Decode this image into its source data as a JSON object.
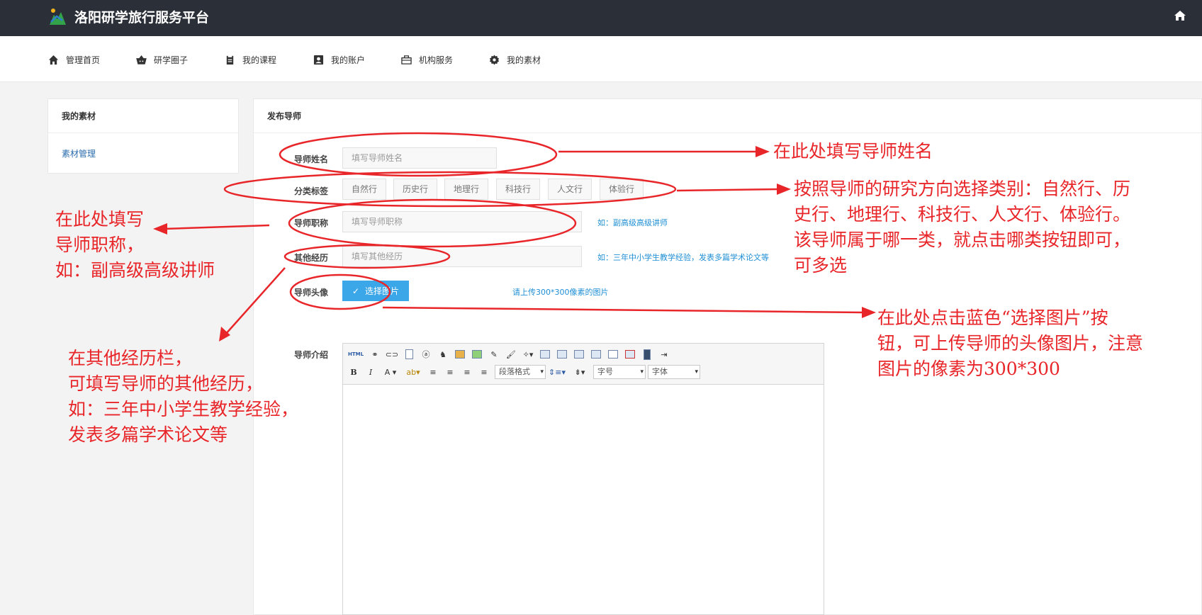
{
  "app": {
    "title": "洛阳研学旅行服务平台"
  },
  "nav": [
    {
      "label": "管理首页",
      "icon": "home-icon"
    },
    {
      "label": "研学圈子",
      "icon": "basket-icon"
    },
    {
      "label": "我的课程",
      "icon": "clipboard-icon"
    },
    {
      "label": "我的账户",
      "icon": "account-icon"
    },
    {
      "label": "机构服务",
      "icon": "briefcase-icon"
    },
    {
      "label": "我的素材",
      "icon": "gear-icon"
    }
  ],
  "sidebar": {
    "title": "我的素材",
    "link": "素材管理"
  },
  "form": {
    "title": "发布导师",
    "name_label": "导师姓名",
    "name_placeholder": "填写导师姓名",
    "category_label": "分类标签",
    "categories": [
      "自然行",
      "历史行",
      "地理行",
      "科技行",
      "人文行",
      "体验行"
    ],
    "job_title_label": "导师职称",
    "job_title_placeholder": "填写导师职称",
    "job_title_hint": "如：副高级高级讲师",
    "experience_label": "其他经历",
    "experience_placeholder": "填写其他经历",
    "experience_hint": "如：三年中小学生教学经验，发表多篇学术论文等",
    "avatar_label": "导师头像",
    "avatar_button": "选择图片",
    "avatar_hint": "请上传300*300像素的图片",
    "intro_label": "导师介绍"
  },
  "editor": {
    "paragraph_format": "段落格式",
    "font_size": "字号",
    "font_family": "字体",
    "html_label": "HTML"
  },
  "annotations": {
    "name": "在此处填写导师姓名",
    "category_1": "按照导师的研究方向选择类别：自然行、历",
    "category_2": "史行、地理行、科技行、人文行、体验行。",
    "category_3": "该导师属于哪一类，就点击哪类按钮即可，",
    "category_4": "可多选",
    "job_1": "在此处填写",
    "job_2": "导师职称，",
    "job_3": "如：副高级高级讲师",
    "exp_1": "在其他经历栏，",
    "exp_2": "可填写导师的其他经历，",
    "exp_3": "如：三年中小学生教学经验，",
    "exp_4": "发表多篇学术论文等",
    "avatar_1": "在此处点击蓝色“选择图片”按",
    "avatar_2": "钮，可上传导师的头像图片，注意",
    "avatar_3": "图片的像素为300*300"
  },
  "colors": {
    "topbar": "#2b3038",
    "accent": "#3ba6e8",
    "hint": "#1f8fd5",
    "annotation": "#e8262a"
  }
}
